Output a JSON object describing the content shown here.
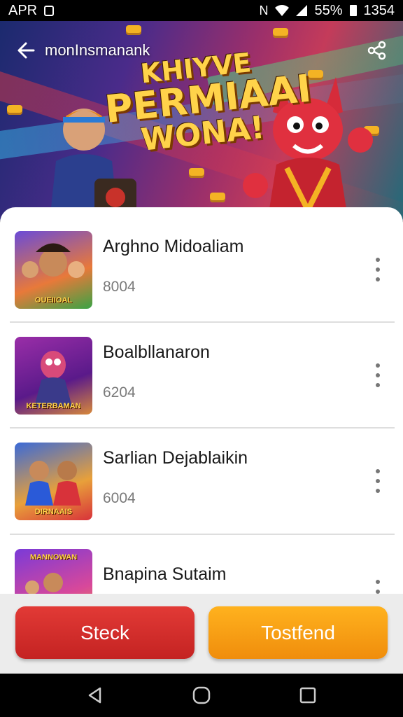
{
  "status_bar": {
    "time_left": "APR",
    "battery": "55%",
    "clock": "1354"
  },
  "header": {
    "title": "monInsmanank"
  },
  "hero": {
    "line1": "KHIYVE",
    "line2": "PERMIAAI",
    "line3": "WONA!"
  },
  "items": [
    {
      "title": "Arghno Midoaliam",
      "subtitle": "8004",
      "thumb_text": "OUEIIOAL"
    },
    {
      "title": "Boalbllanaron",
      "subtitle": "6204",
      "thumb_text": "KETERBAMAN"
    },
    {
      "title": "Sarlian Dejablaikin",
      "subtitle": "6004",
      "thumb_text": "DIRNAAIS"
    },
    {
      "title": "Bnapina Sutaim",
      "subtitle": "",
      "thumb_text": "MANNOWAN"
    }
  ],
  "actions": {
    "stock_label": "Steck",
    "test_label": "Tostfend"
  },
  "colors": {
    "stock": "#d42e2c",
    "test": "#f79e14",
    "sheet": "#ffffff"
  }
}
